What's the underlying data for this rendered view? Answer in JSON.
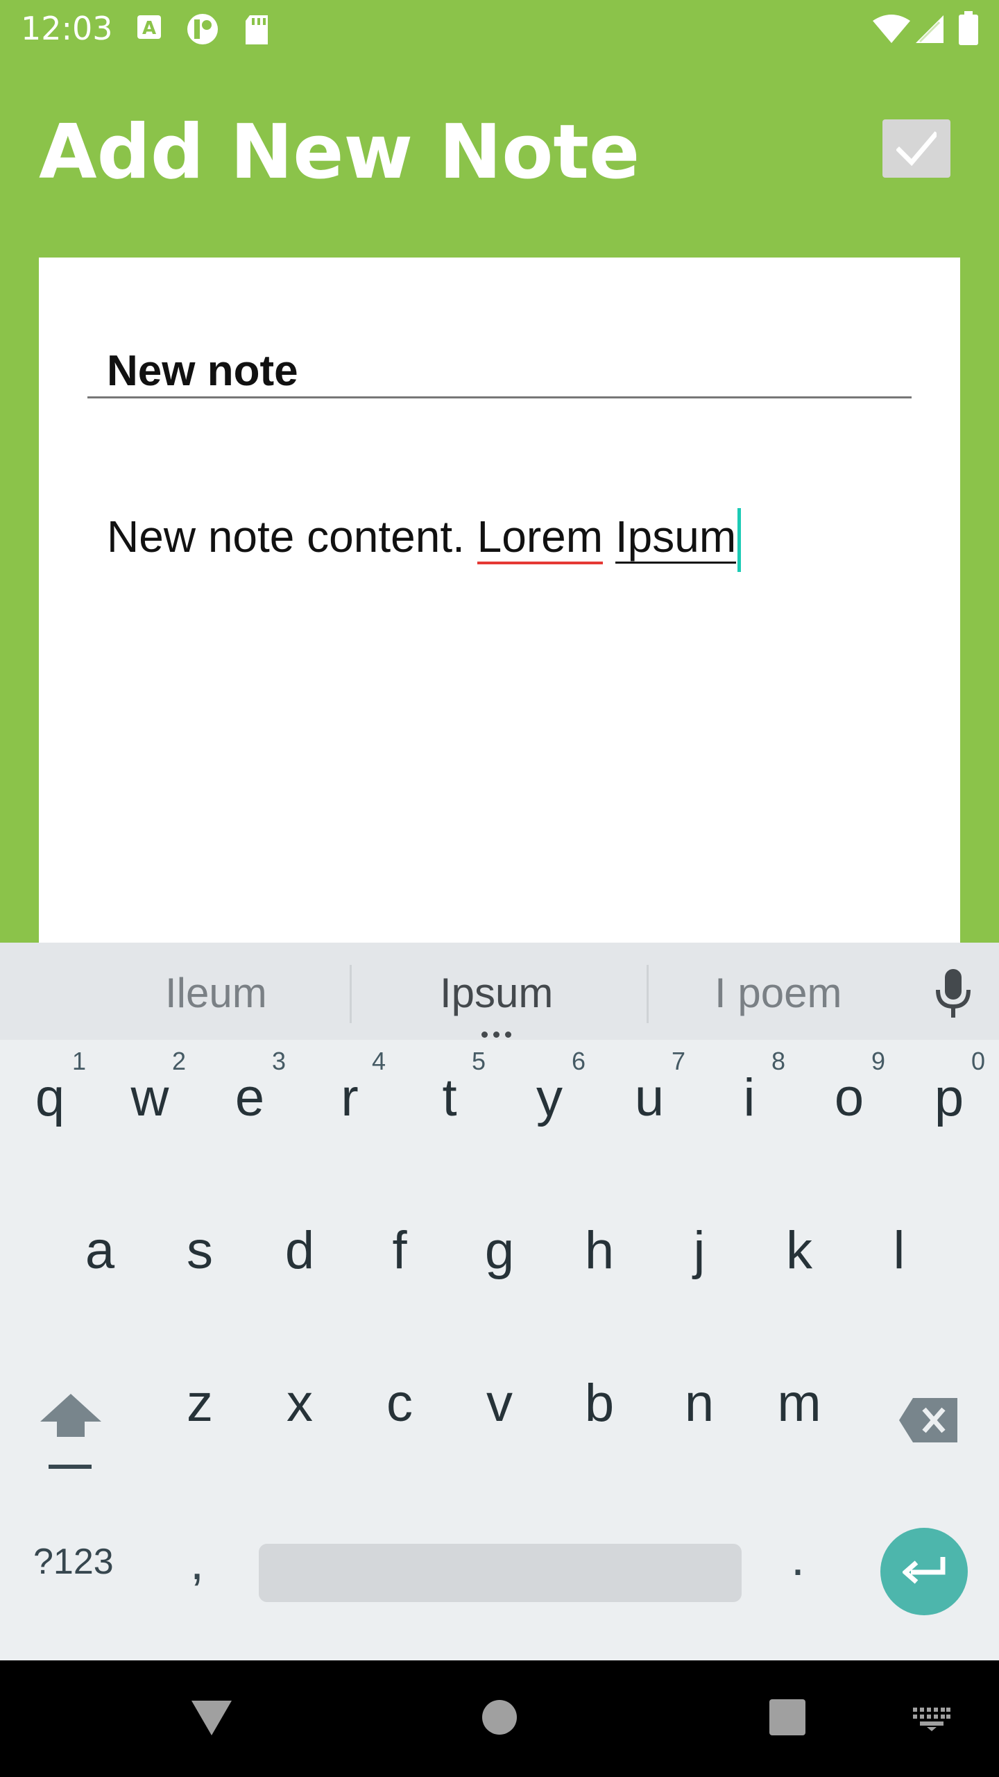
{
  "status_bar": {
    "time": "12:03"
  },
  "app_bar": {
    "title": "Add New Note",
    "save_icon": "check-icon"
  },
  "note": {
    "title_value": "New note",
    "content_prefix": "New note content. ",
    "content_word1": "Lorem",
    "content_space": " ",
    "content_word2": "Ipsum"
  },
  "keyboard": {
    "suggestions": [
      "Ileum",
      "Ipsum",
      "I poem"
    ],
    "row1": [
      {
        "key": "q",
        "num": "1"
      },
      {
        "key": "w",
        "num": "2"
      },
      {
        "key": "e",
        "num": "3"
      },
      {
        "key": "r",
        "num": "4"
      },
      {
        "key": "t",
        "num": "5"
      },
      {
        "key": "y",
        "num": "6"
      },
      {
        "key": "u",
        "num": "7"
      },
      {
        "key": "i",
        "num": "8"
      },
      {
        "key": "o",
        "num": "9"
      },
      {
        "key": "p",
        "num": "0"
      }
    ],
    "row2": [
      "a",
      "s",
      "d",
      "f",
      "g",
      "h",
      "j",
      "k",
      "l"
    ],
    "row3": [
      "z",
      "x",
      "c",
      "v",
      "b",
      "n",
      "m"
    ],
    "symbols_label": "?123",
    "comma_label": ",",
    "period_label": "."
  },
  "colors": {
    "accent": "#8bc34a",
    "enter": "#4db6ac",
    "caret": "#1ccbb5"
  }
}
